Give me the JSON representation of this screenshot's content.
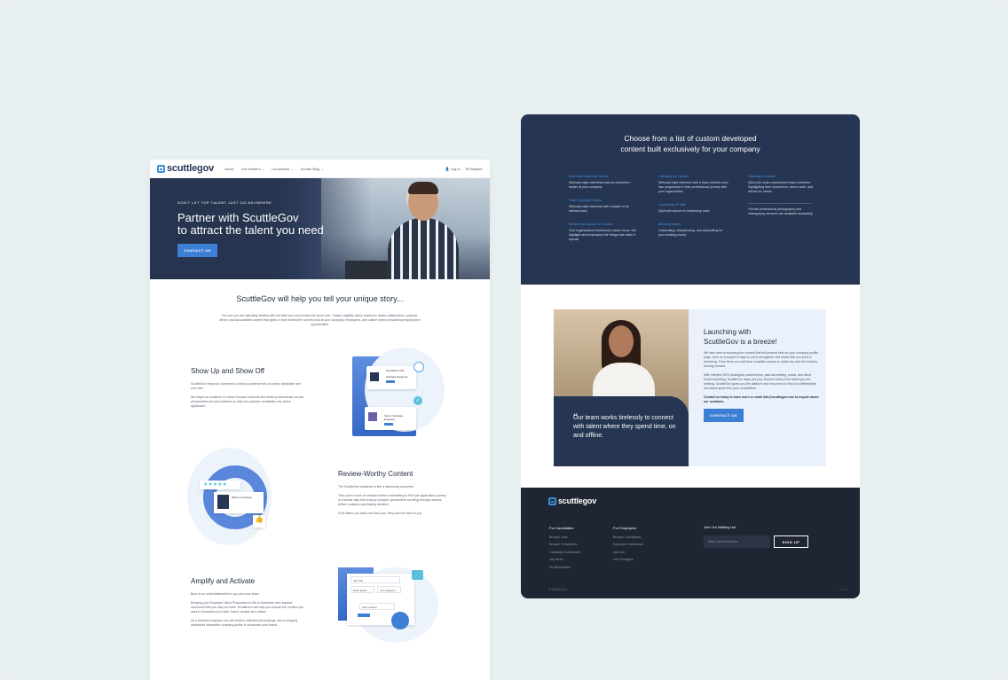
{
  "left_page": {
    "nav": {
      "logo": "scuttlegov",
      "links": [
        "About",
        "Job Seekers ⌄",
        "Companies ⌄",
        "Scuttle Blog ⌄"
      ],
      "login": "Log in",
      "register": "Register"
    },
    "hero": {
      "eyebrow": "DON'T LET TOP TALENT JUST GO ANYWHERE",
      "title_line1": "Partner with ScuttleGov",
      "title_line2": "to attract the talent you need",
      "cta": "CONTACT US"
    },
    "intro": {
      "title": "ScuttleGov will help you tell your unique story...",
      "body": "The one you are intimately familiar with but wish you could share the world over. Today's digitally active workforce seeks collaborative, purpose-driven and accountable content that gives a more behind the scenes look at your company, employees, and culture when considering employment opportunities."
    },
    "sections": [
      {
        "title": "Show Up and Show Off",
        "p1": "ScuttleGov helps you transform a curious audience into an active candidate and core hire.",
        "p2": "We target an audience of career focused students and active professionals across all industries and job functions to help turn passive candidates into active applicants."
      },
      {
        "title": "Review-Worthy Content",
        "p1": "The ScuttleGov audience is like a discerning consumer.",
        "p2": "They put in hours of research before committing to their job application journey in a similar way that a savvy shopper spends time scrolling through reviews before making a purchasing decision.",
        "p3": "If the talent you want can't find you, they can't be sold on you."
      },
      {
        "title": "Amplify and Activate",
        "p1": "Buzz is an understatement for you and your team.",
        "p2": "Bringing your Employer Value Proposition to life is expensive and requires resources that you may not have. ScuttleGov will help you expose the content you want to showcase your jobs, brand, people and culture.",
        "p3": "As a featured employer you will receive unlimited job postings, and a uniquely developed interactive company profile to showcase your brand."
      }
    ],
    "illustrations": {
      "card1_title": "ScuttleGov Hire",
      "card1_sub": "Software Engineer",
      "card2_sub": "Senior Software Engineer",
      "rating_stars": "★★★★★",
      "rating_company": "Wave Consulting",
      "form_labels": [
        "Job Title",
        "Work Email",
        "Job Category",
        "Job Location"
      ]
    }
  },
  "right_page": {
    "title_line1": "Choose from a list of custom developed",
    "title_line2": "content built exclusively for your company",
    "columns": [
      [
        {
          "title": "Executive Interview Series",
          "desc": "Webcast style interviews with an executive / leader at your company"
        },
        {
          "title": "Team Spotlight Series",
          "desc": "Webcast style interview with a leader of an internal team"
        },
        {
          "title": "Behind the Curtain on Culture",
          "desc": "Your organizations intentional culture focus. We highlight and emphasize the things that make it special"
        }
      ],
      [
        {
          "title": "Climbing the Ladder",
          "desc": "Webcast style interview with a team member who has progressed in their professional journey with your organization"
        },
        {
          "title": "Leadership Profile",
          "desc": "Q&A with women in leadership roles"
        },
        {
          "title": "Working Moms",
          "desc": "Celebrating, championing, and advocating for your working moms"
        }
      ],
      [
        {
          "title": "Diversity in Motion",
          "desc": "Q&A with under-represented team members highlighting their experience, career path, and advice for others."
        },
        {
          "title": "",
          "desc": "*Onsite professional photography and videography services are available separately."
        }
      ]
    ],
    "quote": "Our team works tirelessly to connect with talent where they spend time, on and offline.",
    "launch": {
      "title_line1": "Launching with",
      "title_line2": "ScuttleGov is a breeze!",
      "p1": "We take care of exposing the content that will present best for your company profile page. Give us a couple of days to pull it all together and share with you prior to launching. From there you will have complete access to make any and all revisions moving forward.",
      "p2": "With effective SEO strategies, partnerships, paid advertising, social, and direct email marketing, ScuttleGov helps put your brand in front of the talent you are seeking. ScuttleGov gives you the platform and resources to help you differentiate and stand apart from your competitors.",
      "p3": "Contact us today to learn more or email info@scuttlegov.com to inquire about our solutions.",
      "cta": "CONTACT US"
    },
    "footer": {
      "logo": "scuttlegov",
      "candidates_title": "For Candidates",
      "candidates": [
        "Browse Jobs",
        "Browse Companies",
        "Candidate Dashboard",
        "Job Alerts",
        "My Bookmarks"
      ],
      "employers_title": "For Employers",
      "employers": [
        "Browse Candidates",
        "Employer Dashboard",
        "Add Job",
        "Job Packages"
      ],
      "mailing_title": "Join Our Mailing List",
      "email_placeholder": "Enter your email here",
      "signup": "SIGN UP",
      "copyright": "© ScuttleGov",
      "social": "f  in  tw"
    }
  }
}
